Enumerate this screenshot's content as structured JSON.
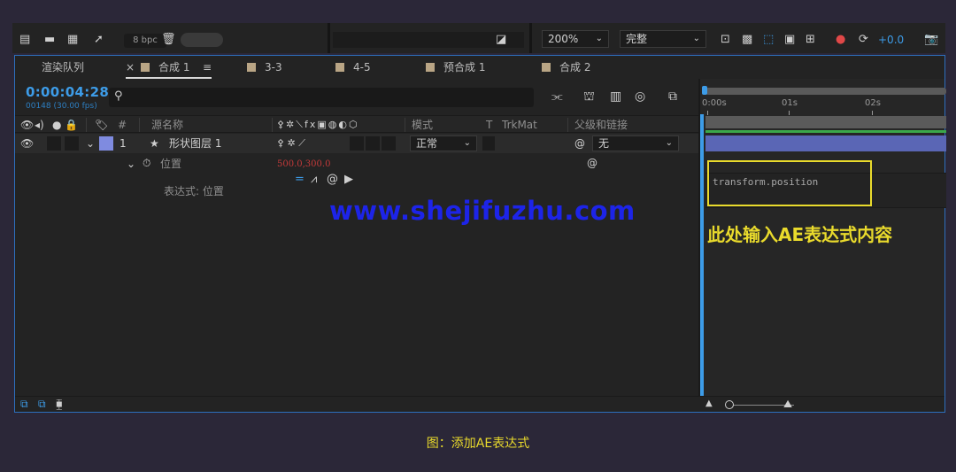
{
  "toolbar": {
    "bpc_label": "8 bpc",
    "zoom_value": "200%",
    "resolution_value": "完整",
    "exposure_value": "+0.0"
  },
  "tabs": [
    {
      "label": "渲染队列"
    },
    {
      "label": "合成 1",
      "active": true
    },
    {
      "label": "3-3"
    },
    {
      "label": "4-5"
    },
    {
      "label": "预合成 1"
    },
    {
      "label": "合成 2"
    }
  ],
  "timecode": "0:00:04:28",
  "timecode_sub": "00148 (30.00 fps)",
  "columns": {
    "hash": "#",
    "source_name": "源名称",
    "mode": "模式",
    "t": "T",
    "trkmat": "TrkMat",
    "parent": "父级和链接"
  },
  "layer": {
    "index": "1",
    "name": "形状图层 1",
    "mode": "正常",
    "parent": "无"
  },
  "properties": {
    "position_label": "位置",
    "position_value": "500.0,300.0",
    "expression_label": "表达式: 位置"
  },
  "timeline": {
    "ticks": [
      "0:00s",
      "01s",
      "02s"
    ],
    "expression_text": "transform.position",
    "annotation": "此处输入AE表达式内容"
  },
  "watermark": "www.shejifuzhu.com",
  "caption": "图：添加AE表达式",
  "colors": {
    "accent": "#3d9ce8",
    "highlight": "#e9da2c",
    "label_swatch": "#7f8be0",
    "layer_bar": "#5a66b5",
    "watermark": "#1d24e8"
  }
}
